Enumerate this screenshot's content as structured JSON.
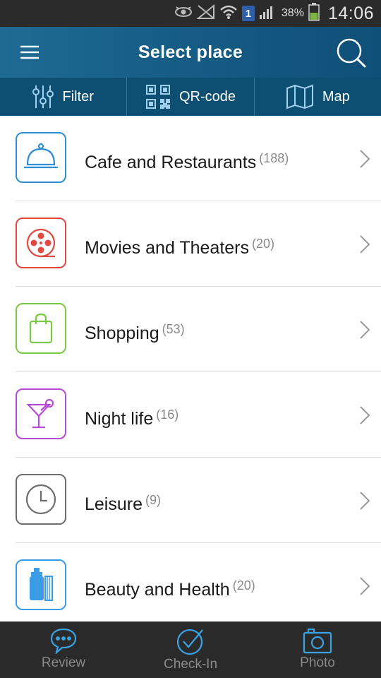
{
  "status_bar": {
    "battery_percent": "38%",
    "time": "14:06",
    "notification_badge": "1",
    "icons": [
      "eye-icon",
      "muted-signal-icon",
      "wifi-icon",
      "notification-badge",
      "cell-signal-icon",
      "battery-icon"
    ]
  },
  "header": {
    "title": "Select place",
    "menu_icon": "hamburger-menu-icon",
    "search_icon": "search-icon"
  },
  "toolbar": {
    "filter_label": "Filter",
    "qr_label": "QR-code",
    "map_label": "Map"
  },
  "categories": [
    {
      "label": "Cafe and Restaurants",
      "count": "(188)",
      "icon": "cloche-icon",
      "color": "#2f8fd6"
    },
    {
      "label": "Movies and Theaters",
      "count": "(20)",
      "icon": "film-reel-icon",
      "color": "#e2483f"
    },
    {
      "label": "Shopping",
      "count": "(53)",
      "icon": "shopping-bag-icon",
      "color": "#7ac943"
    },
    {
      "label": "Night life",
      "count": "(16)",
      "icon": "cocktail-icon",
      "color": "#b84bd6"
    },
    {
      "label": "Leisure",
      "count": "(9)",
      "icon": "clock-icon",
      "color": "#6e6e6e"
    },
    {
      "label": "Beauty and Health",
      "count": "(20)",
      "icon": "cosmetics-icon",
      "color": "#3a9be6"
    }
  ],
  "bottom_nav": {
    "review_label": "Review",
    "checkin_label": "Check-In",
    "photo_label": "Photo"
  },
  "colors": {
    "header_bg": "#1a628c",
    "toolbar_bg": "#0c4f72",
    "nav_accent": "#3aa3e6"
  }
}
